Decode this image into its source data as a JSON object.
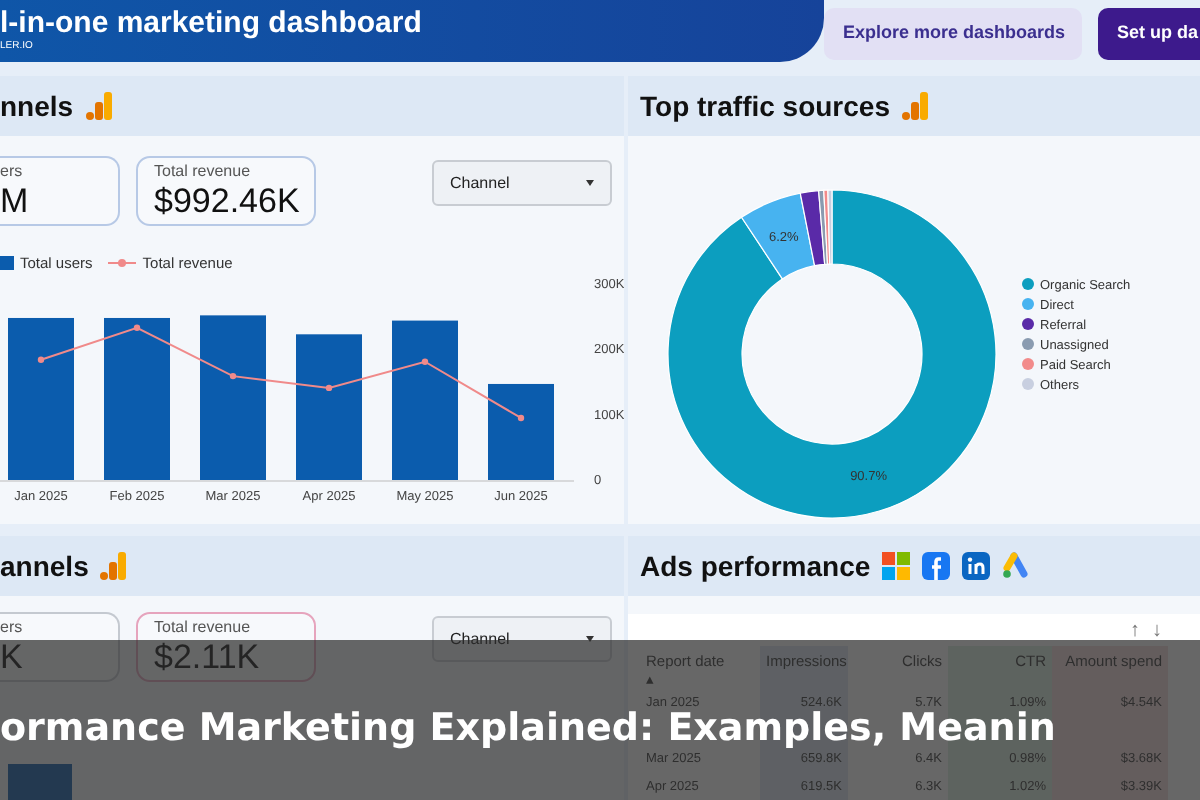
{
  "header": {
    "title": "l-in-one marketing dashboard",
    "subtitle": "LER.IO",
    "buttons": [
      {
        "label": "Explore more dashboards",
        "kind": "secondary"
      },
      {
        "label": "Set up da",
        "kind": "primary"
      }
    ]
  },
  "channels": {
    "title": "nnels",
    "kpis": [
      {
        "label": "ers",
        "value": "M"
      },
      {
        "label": "Total revenue",
        "value": "$992.46K"
      }
    ],
    "dropdown": "Channel",
    "chart_data": {
      "type": "bar",
      "categories": [
        "Jan 2025",
        "Feb 2025",
        "Mar 2025",
        "Apr 2025",
        "May 2025",
        "Jun 2025"
      ],
      "ylim": [
        0,
        300000
      ],
      "yticks": [
        {
          "value": 0,
          "label": "0"
        },
        {
          "value": 100000,
          "label": "100K"
        },
        {
          "value": 200000,
          "label": "200K"
        },
        {
          "value": 300000,
          "label": "300K"
        }
      ],
      "series": [
        {
          "name": "Total users",
          "type": "bar",
          "color": "#0b5cad",
          "values": [
            248000,
            248000,
            252000,
            223000,
            244000,
            147000
          ]
        },
        {
          "name": "Total revenue",
          "type": "line",
          "marker": "circle",
          "color": "#f08a8a",
          "values": [
            184000,
            233000,
            159000,
            141000,
            181000,
            95000
          ]
        }
      ]
    }
  },
  "traffic": {
    "title": "Top traffic sources",
    "chart_data": {
      "type": "donut",
      "legend": true,
      "categories": [
        "Organic Search",
        "Direct",
        "Referral",
        "Unassigned",
        "Paid Search",
        "Others"
      ],
      "series": [
        {
          "values": [
            90.7,
            6.2,
            1.8,
            0.5,
            0.4,
            0.4
          ],
          "value_labels": [
            "90.7%",
            "6.2%",
            null,
            null,
            null,
            null
          ]
        }
      ],
      "colors": [
        "#0c9ebf",
        "#47b3f0",
        "#5a2aa8",
        "#8a9bb0",
        "#f28b8b",
        "#c8cfe0"
      ]
    }
  },
  "channels2": {
    "title": "annels",
    "kpis": [
      {
        "label": "ers",
        "value": "K"
      },
      {
        "label": "Total revenue",
        "value": "$2.11K"
      }
    ],
    "dropdown": "Channel"
  },
  "ads": {
    "title": "Ads performance",
    "sort_buttons": [
      "↑",
      "↓"
    ],
    "columns": [
      "Report date",
      "Impressions",
      "Clicks",
      "CTR",
      "Amount spend"
    ],
    "sort_mark": "▴",
    "rows": [
      [
        "Jan 2025",
        "524.6K",
        "5.7K",
        "1.09%",
        "$4.54K"
      ],
      [],
      [
        "Mar 2025",
        "659.8K",
        "6.4K",
        "0.98%",
        "$3.68K"
      ],
      [
        "Apr 2025",
        "619.5K",
        "6.3K",
        "1.02%",
        "$3.39K"
      ]
    ]
  },
  "caption": "ormance Marketing Explained: Examples, Meanin"
}
